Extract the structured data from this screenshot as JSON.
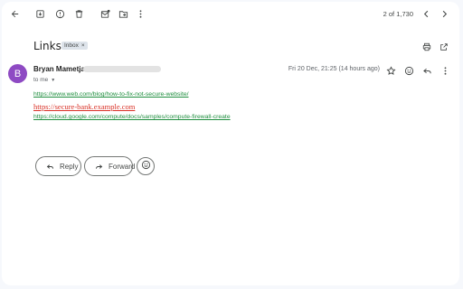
{
  "toolbar": {
    "icons": [
      "back-arrow-icon",
      "archive-icon",
      "report-spam-icon",
      "delete-icon",
      "mark-unread-icon",
      "move-to-icon",
      "more-vert-icon",
      "chevron-left-icon",
      "chevron-right-icon"
    ],
    "pager": "2 of 1,730"
  },
  "email": {
    "subject": "Links",
    "label": "Inbox",
    "label_close": "×",
    "avatar_letter": "B",
    "sender_name": "Bryan Mametja",
    "to_line": "to me",
    "date": "Fri 20 Dec, 21:25 (14 hours ago)",
    "links": [
      "https://www.web.com/blog/how-to-fix-not-secure-website/",
      "https://secure-bank.example.com",
      "https://cloud.google.com/compute/docs/samples/compute-firewall-create"
    ]
  },
  "actions": {
    "reply": "Reply",
    "forward": "Forward"
  },
  "colors": {
    "avatar": "#8e4ac3",
    "link_green": "#1e8e3e",
    "link_red": "#d93025",
    "background": "#f6f8fc"
  }
}
